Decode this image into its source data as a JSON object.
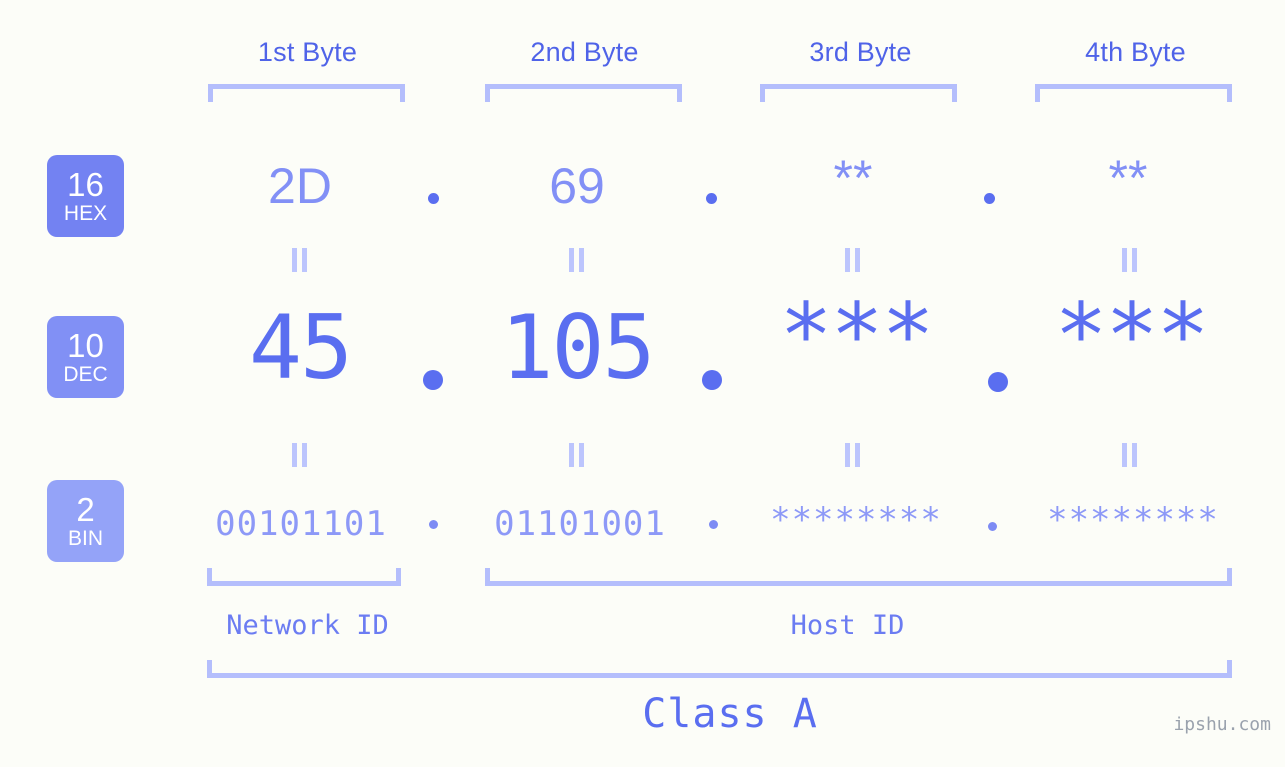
{
  "theme": {
    "background": "#fcfdf8",
    "accent_strong": "#4f63e8",
    "accent_mid": "#7f8cf5",
    "accent_light": "#b4befc",
    "badge_hex_bg": "#7382f2",
    "badge_dec_bg": "#8190f5",
    "badge_bin_bg": "#94a3f8",
    "watermark_color": "#9aa2ad"
  },
  "headers": {
    "bytes": [
      {
        "label": "1st Byte"
      },
      {
        "label": "2nd Byte"
      },
      {
        "label": "3rd Byte"
      },
      {
        "label": "4th Byte"
      }
    ]
  },
  "rows": [
    {
      "base_number": "16",
      "base_name": "HEX",
      "values": [
        "2D",
        "69",
        "**",
        "**"
      ]
    },
    {
      "base_number": "10",
      "base_name": "DEC",
      "values": [
        "45",
        "105",
        "***",
        "***"
      ]
    },
    {
      "base_number": "2",
      "base_name": "BIN",
      "values": [
        "00101101",
        "01101001",
        "********",
        "********"
      ]
    }
  ],
  "separators": {
    "dot": "."
  },
  "equality": {
    "glyph": "||"
  },
  "footer": {
    "network_id_label": "Network ID",
    "host_id_label": "Host ID",
    "class_label": "Class A",
    "watermark": "ipshu.com"
  }
}
